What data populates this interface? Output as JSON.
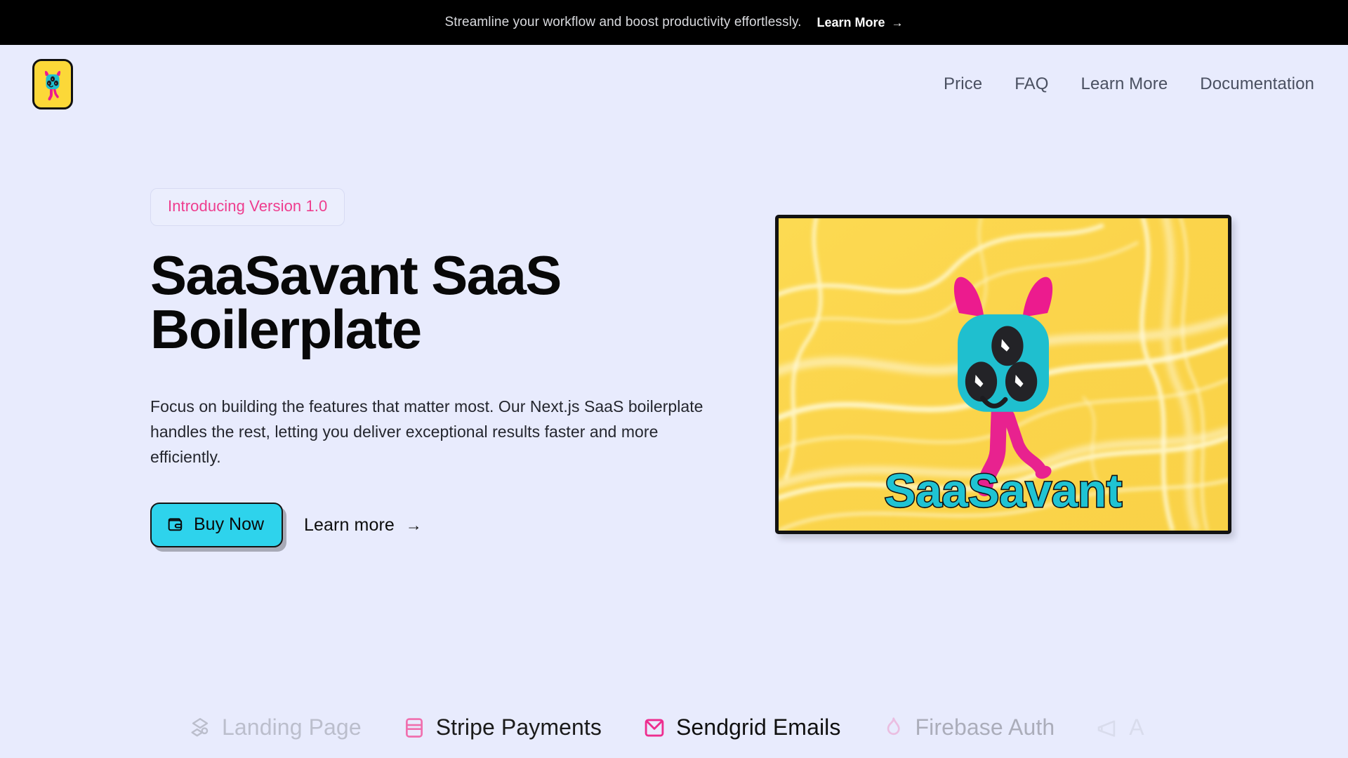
{
  "announcement": {
    "message": "Streamline your workflow and boost productivity effortlessly.",
    "link_label": "Learn More",
    "arrow": "→"
  },
  "header": {
    "logo_name": "saasavant-logo",
    "nav": [
      {
        "label": "Price"
      },
      {
        "label": "FAQ"
      },
      {
        "label": "Learn More"
      },
      {
        "label": "Documentation"
      }
    ]
  },
  "hero": {
    "badge": "Introducing Version 1.0",
    "title": "SaaSavant SaaS Boilerplate",
    "description": "Focus on building the features that matter most. Our Next.js SaaS boilerplate handles the rest, letting you deliver exceptional results faster and more efficiently.",
    "primary_cta": "Buy Now",
    "primary_cta_icon": "wallet-icon",
    "secondary_cta": "Learn more",
    "secondary_cta_arrow": "→",
    "image_caption": "SaaSavant"
  },
  "features": [
    {
      "label": "Landing Page",
      "icon": "landing-page-icon"
    },
    {
      "label": "Stripe Payments",
      "icon": "credit-card-icon"
    },
    {
      "label": "Sendgrid Emails",
      "icon": "envelope-icon"
    },
    {
      "label": "Firebase Auth",
      "icon": "flame-icon"
    },
    {
      "label": "A",
      "icon": "megaphone-icon"
    }
  ],
  "colors": {
    "page_background": "#e8ebfd",
    "banner_background": "#000000",
    "accent_cyan": "#2ed3ec",
    "accent_pink": "#ee3d8e",
    "logo_yellow": "#fcd838",
    "hero_yellow": "#fcd857",
    "text_dark": "#080808",
    "nav_text": "#4a5061"
  }
}
